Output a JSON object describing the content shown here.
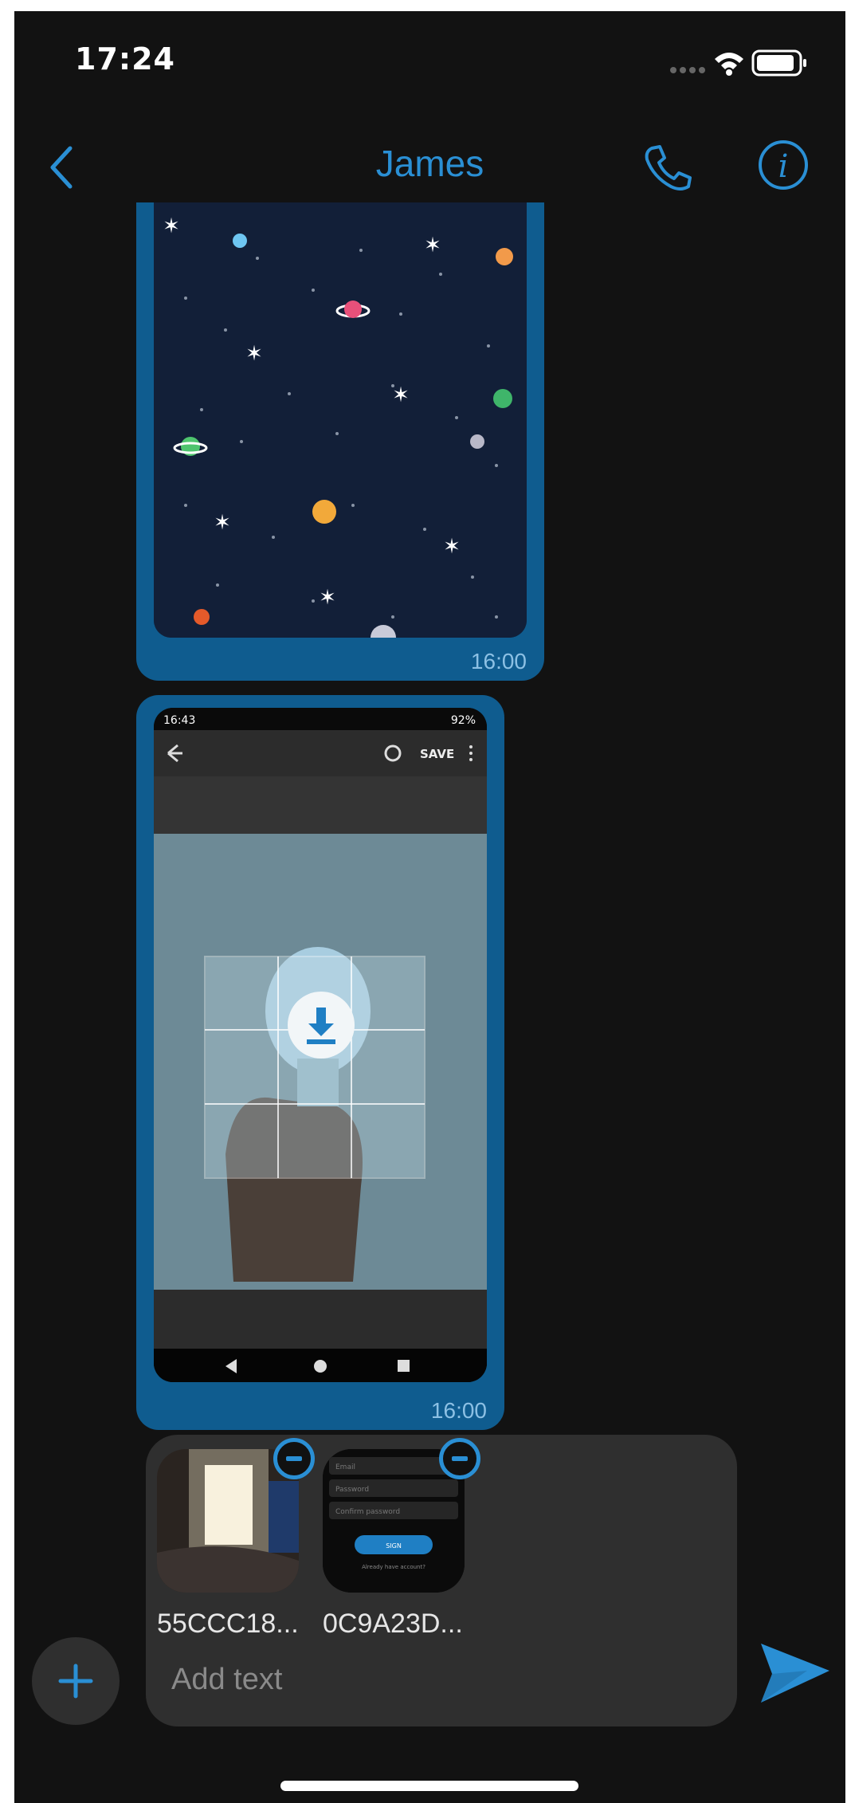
{
  "status_bar": {
    "time": "17:24",
    "icons": [
      "signal-icon",
      "wifi-icon",
      "battery-icon"
    ]
  },
  "header": {
    "title": "James",
    "back_icon": "chevron-left-icon",
    "call_icon": "phone-icon",
    "info_icon": "info-icon"
  },
  "messages": [
    {
      "type": "image",
      "description_icon": "space-wallpaper-image",
      "time": "16:00"
    },
    {
      "type": "image",
      "time": "16:00",
      "screenshot": {
        "status_time": "16:43",
        "status_battery": "92%",
        "toolbar_action": "SAVE",
        "download_icon": "download-icon"
      }
    }
  ],
  "composer": {
    "attachments": [
      {
        "filename": "55CCC18...",
        "thumb": "room-photo"
      },
      {
        "filename": "0C9A23D...",
        "thumb": "login-screen",
        "mini_fields": [
          "Email",
          "Password",
          "Confirm password"
        ],
        "mini_button": "SIGN",
        "mini_link": "Already have account?"
      }
    ],
    "placeholder": "Add text"
  },
  "colors": {
    "accent": "#2a8fd4",
    "bubble": "#0f5c8f",
    "background": "#121212",
    "composer": "#2f2f2f"
  }
}
